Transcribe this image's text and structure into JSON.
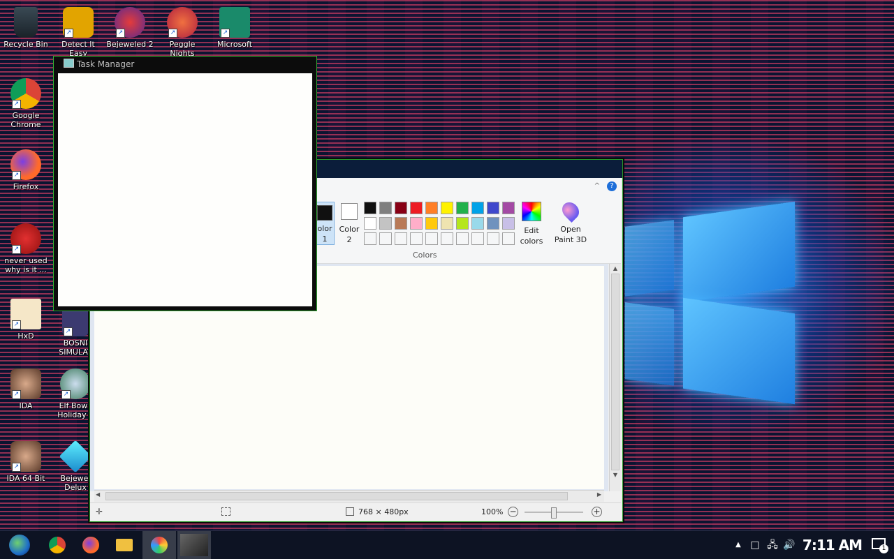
{
  "desktop": {
    "icons": [
      {
        "label": "Recycle Bin"
      },
      {
        "label": "Detect It Easy"
      },
      {
        "label": "Bejeweled 2"
      },
      {
        "label": "Peggle Nights"
      },
      {
        "label": "Microsoft"
      },
      {
        "label": "Google Chrome"
      },
      {
        "label": "Firefox"
      },
      {
        "label": "never used why is it ..."
      },
      {
        "label": "HxD"
      },
      {
        "label": "BOSNI SIMULAT"
      },
      {
        "label": "IDA"
      },
      {
        "label": "Elf Bowli Holiday P"
      },
      {
        "label": "IDA 64 Bit"
      },
      {
        "label": "Bejewel Delux"
      }
    ]
  },
  "task_manager": {
    "title": "Task Manager"
  },
  "paint": {
    "ribbon": {
      "color1_label": "olor 1",
      "color2_label": "Color 2",
      "edit_colors_label": "Edit colors",
      "open_paint3d_label": "Open Paint 3D",
      "colors_group_label": "Colors",
      "help_glyph": "?",
      "collapse_glyph": "^",
      "palette_row1": [
        "#101010",
        "#7f7f7f",
        "#880015",
        "#ed1c24",
        "#ff7f27",
        "#fff200",
        "#22b14c",
        "#00a2e8",
        "#3f48cc",
        "#a349a4"
      ],
      "palette_row2": [
        "#ffffff",
        "#c3c3c3",
        "#b97a57",
        "#ffaec9",
        "#ffc90e",
        "#efe4b0",
        "#b5e61d",
        "#99d9ea",
        "#7092be",
        "#c8bfe7"
      ]
    },
    "status": {
      "dimensions": "768 × 480px",
      "zoom": "100%"
    }
  },
  "taskbar": {
    "clock": "7:11 AM",
    "notification_count": "1"
  }
}
